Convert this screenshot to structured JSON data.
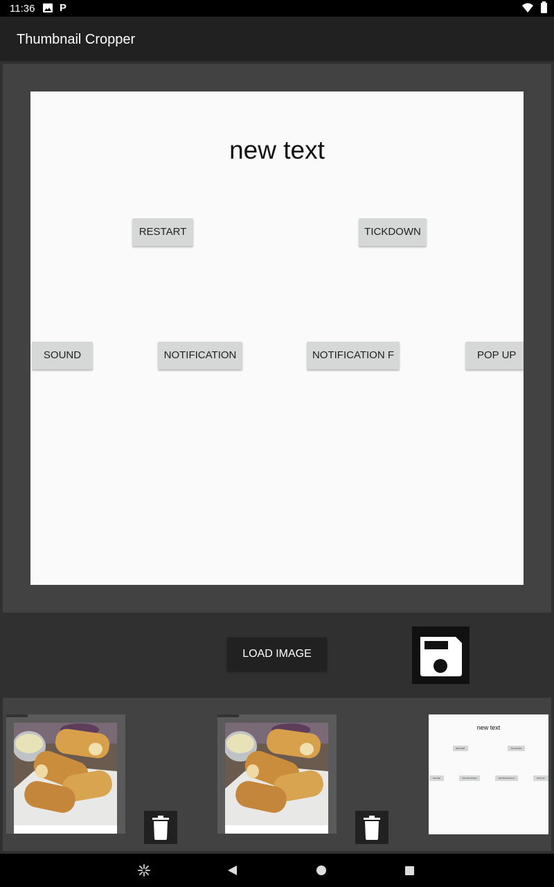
{
  "status_bar": {
    "time": "11:36",
    "icons": [
      "image-icon",
      "p-app-icon",
      "wifi-icon",
      "battery-icon"
    ],
    "p_glyph": "P"
  },
  "app_bar": {
    "title": "Thumbnail Cropper"
  },
  "preview": {
    "heading": "new text",
    "buttons": {
      "restart": "RESTART",
      "tickdown": "TICKDOWN",
      "sound": "SOUND",
      "notification": "NOTIFICATION",
      "notification_f": "NOTIFICATION F",
      "pop_up": "POP UP"
    }
  },
  "controls": {
    "load_image_label": "LOAD IMAGE",
    "save_icon": "floppy-disk-icon"
  },
  "thumbnails": [
    {
      "kind": "food-photo",
      "has_delete": true,
      "delete_icon": "trash-icon"
    },
    {
      "kind": "food-photo",
      "has_delete": true,
      "delete_icon": "trash-icon"
    },
    {
      "kind": "text-layout-preview",
      "has_delete": false
    }
  ],
  "nav_bar": {
    "icons": [
      "assistant-icon",
      "back-icon",
      "home-icon",
      "recents-icon"
    ]
  },
  "colors": {
    "background": "#303030",
    "app_bar": "#212121",
    "panel": "#424242",
    "preview_bg": "#fafafa",
    "button_gray": "#d6d7d7"
  }
}
